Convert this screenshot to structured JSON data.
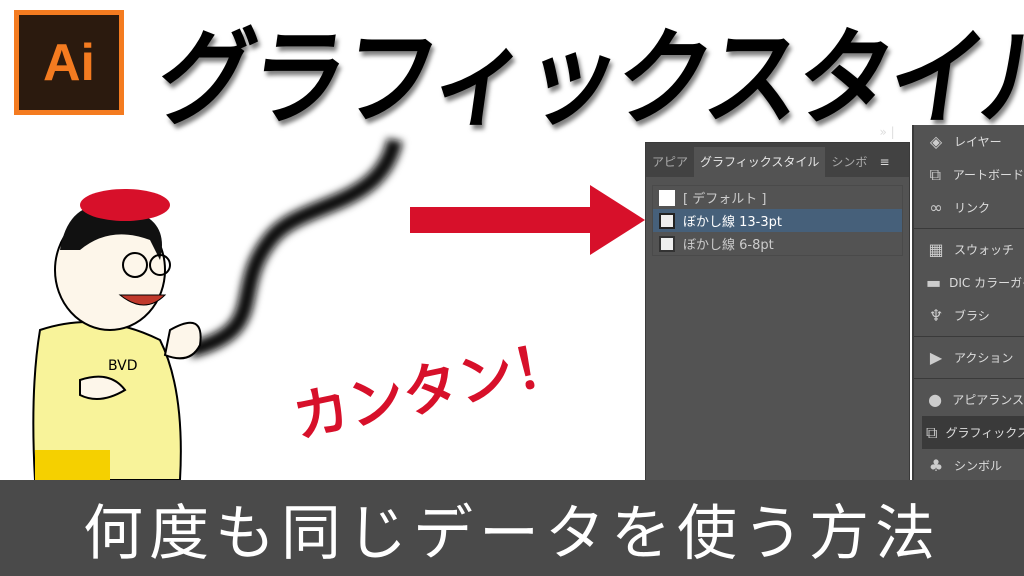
{
  "logo": {
    "text": "Ai"
  },
  "title": "グラフィックスタイル",
  "exclaim": "カンタン！",
  "banner": "何度も同じデータを使う方法",
  "character": {
    "shirt_text": "BVD"
  },
  "panel": {
    "tabs": [
      {
        "label": "アピア"
      },
      {
        "label": "グラフィックスタイル",
        "active": true
      },
      {
        "label": "シンボ"
      }
    ],
    "more": "»",
    "menu": "≡",
    "styles": [
      {
        "label": "[ デフォルト ]"
      },
      {
        "label": "ぼかし線 13-3pt",
        "selected": true
      },
      {
        "label": "ぼかし線 6-8pt"
      }
    ]
  },
  "dock": {
    "items": [
      {
        "label": "レイヤー",
        "icon": "layers-icon"
      },
      {
        "label": "アートボード",
        "icon": "artboard-icon"
      },
      {
        "label": "リンク",
        "icon": "link-icon"
      },
      {
        "label": "スウォッチ",
        "icon": "swatches-icon"
      },
      {
        "label": "DIC カラーガイド",
        "icon": "color-guide-icon"
      },
      {
        "label": "ブラシ",
        "icon": "brush-icon"
      },
      {
        "label": "アクション",
        "icon": "play-icon"
      },
      {
        "label": "アピアランス",
        "icon": "appearance-icon"
      },
      {
        "label": "グラフィックスタイル",
        "icon": "graphic-styles-icon",
        "active": true
      },
      {
        "label": "シンボル",
        "icon": "club-icon"
      }
    ]
  },
  "colors": {
    "accent": "#d7102a",
    "ai_orange": "#f47b20",
    "panel": "#535353",
    "selected": "#46607a"
  }
}
